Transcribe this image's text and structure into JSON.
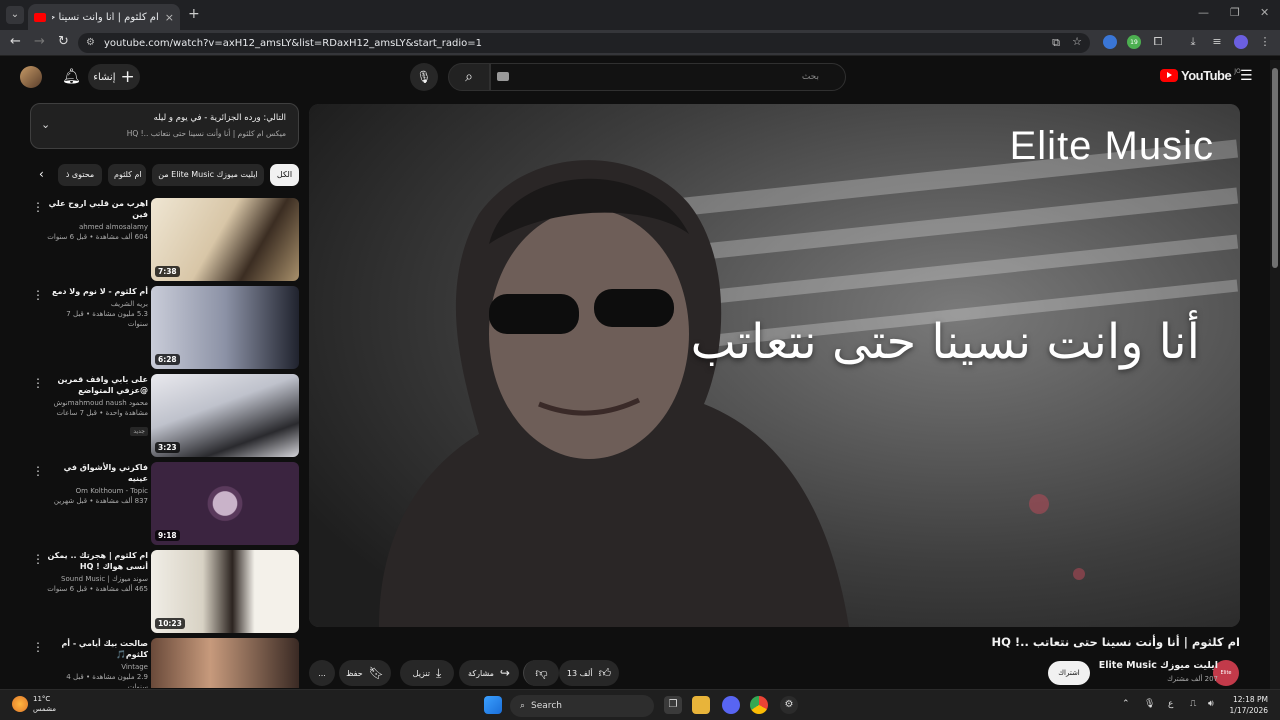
{
  "browser": {
    "tab_title": "ام كلثوم | أنا وأنت نسينا حتى نتعاتب ..!",
    "url": "youtube.com/watch?v=axH12_amsLY&list=RDaxH12_amsLY&start_radio=1",
    "extension_badge": "19"
  },
  "header": {
    "create_label": "إنشاء",
    "search_placeholder": "بحث",
    "logo_text": "YouTube",
    "logo_region": "JO"
  },
  "queue": {
    "next_label": "التالي: ورده الجزائرية - في يوم و ليله",
    "mix_label": "ميكس ام كلثوم | أنا وأنت نسينا حتى نتعاتب ..! HQ"
  },
  "chips": [
    {
      "label": "الكل",
      "active": true
    },
    {
      "label": "من Elite Music ايليت ميوزك",
      "active": false
    },
    {
      "label": "ام كلثوم",
      "active": false
    },
    {
      "label": "محتوى ذ",
      "active": false
    }
  ],
  "playlist": [
    {
      "title": "اهرب من قلبي اروح علي فين",
      "channel": "ahmed almosalamy",
      "views": "604 ألف مشاهدة • قبل 6 سنوات",
      "duration": "7:38",
      "badge": ""
    },
    {
      "title": "أم كلثوم - لا نوم ولا دمع",
      "channel": "بريه الشريف",
      "views": "5.3 مليون مشاهدة • قبل 7 سنوات",
      "duration": "6:28",
      "badge": ""
    },
    {
      "title": "على بابي واقف قمرين @عزفي المتواضع",
      "channel": "محمود ‎mahmoud naush‏نوش",
      "views": "مشاهدة واحدة • قبل 7 ساعات",
      "duration": "3:23",
      "badge": "جديد"
    },
    {
      "title": "فاكرني والأشواق في عينيه",
      "channel": "Om Kolthoum - Topic",
      "views": "837 ألف مشاهدة • قبل شهرين",
      "duration": "9:18",
      "badge": ""
    },
    {
      "title": "ام كلثوم | هجرتك .. يمكن أنسى هواك ! HQ",
      "channel": "سوند ميوزك | Sound Music",
      "views": "465 ألف مشاهدة • قبل 6 سنوات",
      "duration": "10:23",
      "badge": ""
    },
    {
      "title": "صالحت بيك أيامي - أم كلثوم🎵",
      "channel": "Vintage",
      "views": "2.9 مليون مشاهدة • قبل 4 سنوات",
      "duration": "",
      "badge": ""
    }
  ],
  "video": {
    "brand_text": "Elite Music",
    "lyric_text": "أنا وانت نسينا حتى نتعاتب",
    "title": "ام كلثوم | أنا وأنت نسينا حتى نتعاتب ..! HQ",
    "like_count": "13 ألف",
    "share_label": "مشاركة",
    "download_label": "تنزيل",
    "save_label": "حفظ",
    "more_label": "..."
  },
  "channel": {
    "name": "ايليت ميوزك Elite Music",
    "subscribers": "207 ألف مشترك",
    "subscribe_label": "اشتراك",
    "avatar_text": "Elite Music"
  },
  "taskbar": {
    "temperature": "11°C",
    "weather": "مشمس",
    "search_label": "Search",
    "time": "12:18 PM",
    "date": "1/17/2026",
    "lang": "ع"
  },
  "colors": {
    "accent": "#ff0000",
    "background": "#0f0f0f",
    "chip_active": "#f1f1f1"
  }
}
